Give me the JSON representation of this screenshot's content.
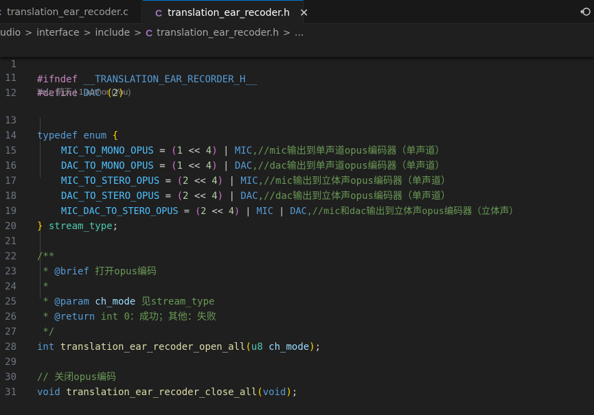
{
  "tabs": [
    {
      "icon": "C",
      "label": "translation_ear_recoder.c",
      "active": false
    },
    {
      "icon": "C",
      "label": "translation_ear_recoder.h",
      "active": true,
      "close": "✕"
    }
  ],
  "breadcrumb": {
    "segments": [
      "udio",
      "interface",
      "include"
    ],
    "file_icon": "C",
    "file": "translation_ear_recoder.h",
    "more": "..."
  },
  "blame": "You, 前天 | 1 author (You)",
  "lines": {
    "l1": {
      "n": "1",
      "kw": "#ifndef",
      "rest": "__TRANSLATION_EAR_RECORDER_H__"
    },
    "l11": {
      "n": "11",
      "kw": "#define",
      "name": "DAC",
      "lp": "(",
      "num": "2",
      "rp": ")"
    },
    "l12": {
      "n": "12"
    },
    "l13": {
      "n": "13",
      "a": "typedef",
      "b": "enum",
      "brace": "{"
    },
    "l14": {
      "n": "14",
      "name": "MIC_TO_MONO_OPUS",
      "eq": " = ",
      "lp": "(",
      "n1": "1",
      "sh": " << ",
      "n2": "4",
      "rp": ")",
      "bar": " | ",
      "m": "MIC",
      "cm": ",//mic输出到单声道opus编码器（单声道）"
    },
    "l15": {
      "n": "15",
      "name": "DAC_TO_MONO_OPUS",
      "eq": " = ",
      "lp": "(",
      "n1": "1",
      "sh": " << ",
      "n2": "4",
      "rp": ")",
      "bar": " | ",
      "m": "DAC",
      "cm": ",//dac输出到单声道opus编码器（单声道）"
    },
    "l16": {
      "n": "16",
      "name": "MIC_TO_STERO_OPUS",
      "eq": " = ",
      "lp": "(",
      "n1": "2",
      "sh": " << ",
      "n2": "4",
      "rp": ")",
      "bar": " | ",
      "m": "MIC",
      "cm": ",//mic输出到立体声opus编码器（单声道）"
    },
    "l17": {
      "n": "17",
      "name": "DAC_TO_STERO_OPUS",
      "eq": " = ",
      "lp": "(",
      "n1": "2",
      "sh": " << ",
      "n2": "4",
      "rp": ")",
      "bar": " | ",
      "m": "DAC",
      "cm": ",//dac输出到立体声opus编码器（单声道）"
    },
    "l18": {
      "n": "18",
      "name": "MIC_DAC_TO_STERO_OPUS",
      "eq": " = ",
      "lp": "(",
      "n1": "2",
      "sh": " << ",
      "n2": "4",
      "rp": ")",
      "bar": " | ",
      "m": "MIC",
      "bar2": " | ",
      "m2": "DAC",
      "cm": ",//mic和dac输出到立体声opus编码器（立体声）"
    },
    "l19": {
      "n": "19",
      "brace": "}",
      "type": " stream_type",
      "semi": ";"
    },
    "l20": {
      "n": "20"
    },
    "l21": {
      "n": "21",
      "cm": "/**"
    },
    "l22": {
      "n": "22",
      "star": " * ",
      "tag": "@brief",
      "cm": " 打开opus编码"
    },
    "l23": {
      "n": "23",
      "cm": " *"
    },
    "l24": {
      "n": "24",
      "star": " * ",
      "tag": "@param",
      "par": " ch_mode",
      "cm": " 见stream_type"
    },
    "l25": {
      "n": "25",
      "star": " * ",
      "tag": "@return",
      "cm": " int 0：成功；其他：失败"
    },
    "l26": {
      "n": "26",
      "cm": " */"
    },
    "l27": {
      "n": "27",
      "t": "int",
      "fn": " translation_ear_recoder_open_all",
      "lp": "(",
      "t2": "u8",
      "p": " ch_mode",
      "rp": ")",
      "semi": ";"
    },
    "l28": {
      "n": "28"
    },
    "l29": {
      "n": "29",
      "cm": "// 关闭opus编码"
    },
    "l30": {
      "n": "30",
      "t": "void",
      "fn": " translation_ear_recoder_close_all",
      "lp": "(",
      "t2": "void",
      "rp": ")",
      "semi": ";"
    },
    "l31": {
      "n": "31"
    }
  },
  "colors": {
    "background": "#1f1f1f",
    "accent": "#0078d4",
    "c_icon": "#a074c4"
  }
}
